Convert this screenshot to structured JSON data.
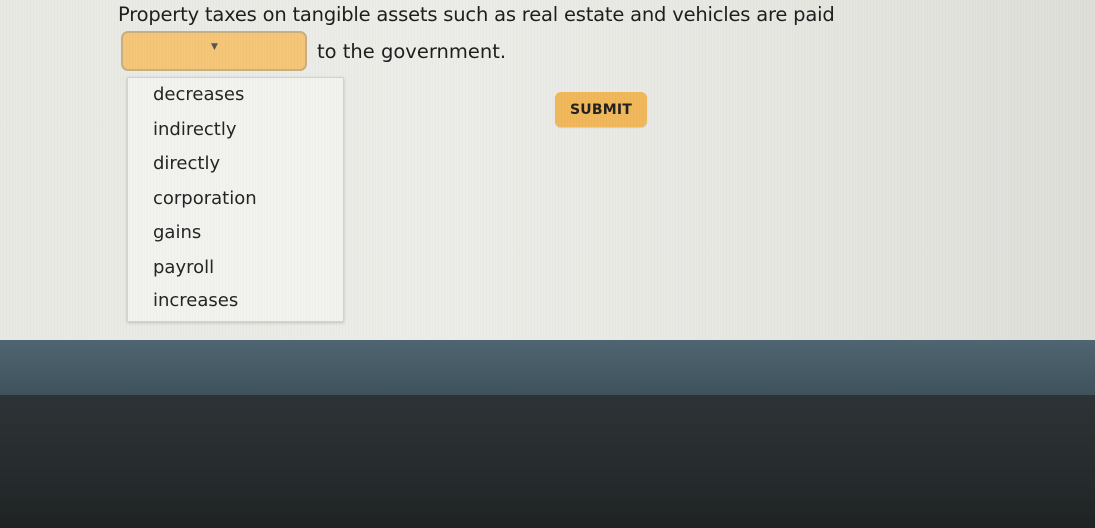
{
  "question": {
    "text_before": "Property taxes on tangible assets such as real estate and vehicles are paid",
    "text_after": "to the government."
  },
  "dropdown": {
    "selected_value": "",
    "caret_icon": "chevron-down-icon",
    "options": [
      "decreases",
      "indirectly",
      "directly",
      "corporation",
      "gains",
      "payroll",
      "increases"
    ]
  },
  "submit": {
    "label": "SUBMIT"
  },
  "colors": {
    "dropdown_fill": "#f5c677",
    "submit_fill": "#f0b85a",
    "page_background": "#ebebe6"
  }
}
